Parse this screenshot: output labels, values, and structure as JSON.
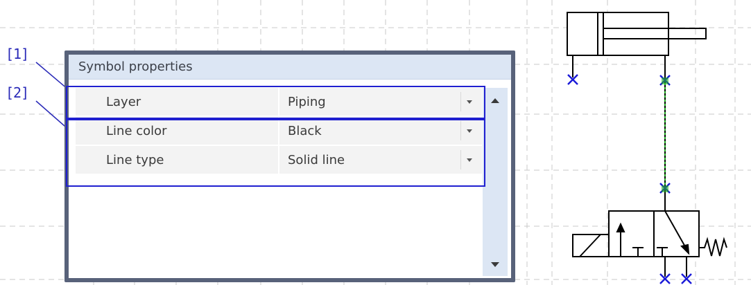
{
  "callouts": [
    "[1]",
    "[2]"
  ],
  "panel": {
    "title": "Symbol properties",
    "rows": [
      {
        "label": "Layer",
        "value": "Piping"
      },
      {
        "label": "Line color",
        "value": "Black"
      },
      {
        "label": "Line type",
        "value": "Solid line"
      }
    ]
  },
  "colors": {
    "panel_frame": "#58627a",
    "title_bar": "#dce6f4",
    "highlight": "#1f1fd0",
    "port_marker": "#1a1ad8",
    "selected_line": "#20b020"
  },
  "icons": [
    "dropdown-arrow-icon",
    "scroll-up-icon",
    "scroll-down-icon"
  ]
}
